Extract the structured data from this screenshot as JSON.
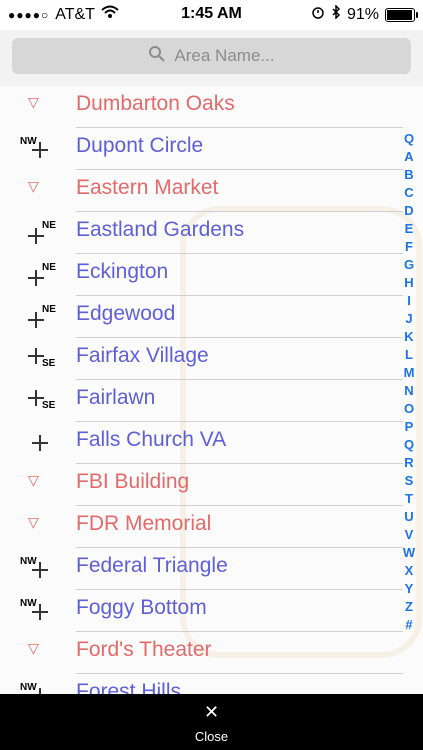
{
  "status": {
    "carrier": "AT&T",
    "time": "1:45 AM",
    "battery": "91%"
  },
  "search": {
    "placeholder": "Area Name..."
  },
  "colors": {
    "red": "#e36a6a",
    "blue": "#5f5fd8"
  },
  "rows": [
    {
      "label": "Dumbarton Oaks",
      "color": "red",
      "icon": "triangle",
      "dir": ""
    },
    {
      "label": "Dupont Circle",
      "color": "blue",
      "icon": "cross",
      "dir": "NW"
    },
    {
      "label": "Eastern Market",
      "color": "red",
      "icon": "triangle",
      "dir": ""
    },
    {
      "label": "Eastland Gardens",
      "color": "blue",
      "icon": "cross",
      "dir": "NE"
    },
    {
      "label": "Eckington",
      "color": "blue",
      "icon": "cross",
      "dir": "NE"
    },
    {
      "label": "Edgewood",
      "color": "blue",
      "icon": "cross",
      "dir": "NE"
    },
    {
      "label": "Fairfax Village",
      "color": "blue",
      "icon": "cross",
      "dir": "SE"
    },
    {
      "label": "Fairlawn",
      "color": "blue",
      "icon": "cross",
      "dir": "SE"
    },
    {
      "label": "Falls Church VA",
      "color": "blue",
      "icon": "cross",
      "dir": ""
    },
    {
      "label": "FBI Building",
      "color": "red",
      "icon": "triangle",
      "dir": ""
    },
    {
      "label": "FDR Memorial",
      "color": "red",
      "icon": "triangle",
      "dir": ""
    },
    {
      "label": "Federal Triangle",
      "color": "blue",
      "icon": "cross",
      "dir": "NW"
    },
    {
      "label": "Foggy Bottom",
      "color": "blue",
      "icon": "cross",
      "dir": "NW"
    },
    {
      "label": "Ford's Theater",
      "color": "red",
      "icon": "triangle",
      "dir": ""
    },
    {
      "label": "Forest Hills",
      "color": "blue",
      "icon": "cross",
      "dir": "NW"
    }
  ],
  "index": [
    "Q",
    "A",
    "B",
    "C",
    "D",
    "E",
    "F",
    "G",
    "H",
    "I",
    "J",
    "K",
    "L",
    "M",
    "N",
    "O",
    "P",
    "Q",
    "R",
    "S",
    "T",
    "U",
    "V",
    "W",
    "X",
    "Y",
    "Z",
    "#"
  ],
  "bottom": {
    "close": "Close"
  }
}
